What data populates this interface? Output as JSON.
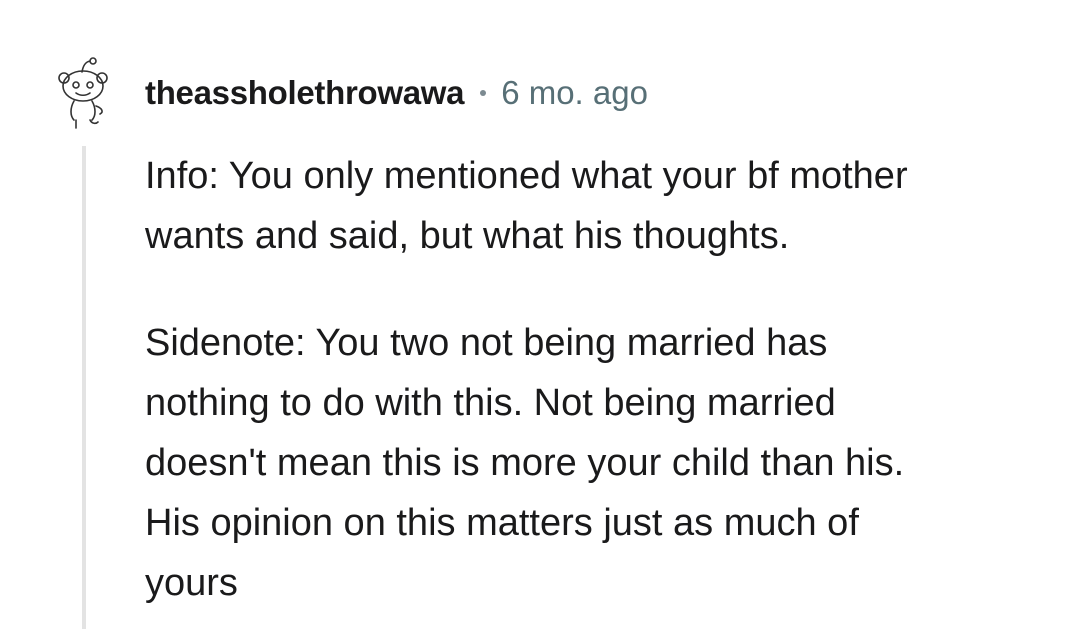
{
  "comment": {
    "avatar_icon": "snoo-avatar-icon",
    "username": "theassholethrowawa",
    "separator": "•",
    "timestamp": "6 mo. ago",
    "paragraphs": [
      "Info: You only mentioned what your bf mother\nwants and said, but what his thoughts.",
      "Sidenote: You two not being married has\nnothing to do with this. Not being married\ndoesn't mean this is more your child than his.\nHis opinion on this matters just as much of\nyours"
    ]
  },
  "colors": {
    "text": "#1a1a1b",
    "meta": "#576f76",
    "thread_line": "#e3e3e3"
  }
}
